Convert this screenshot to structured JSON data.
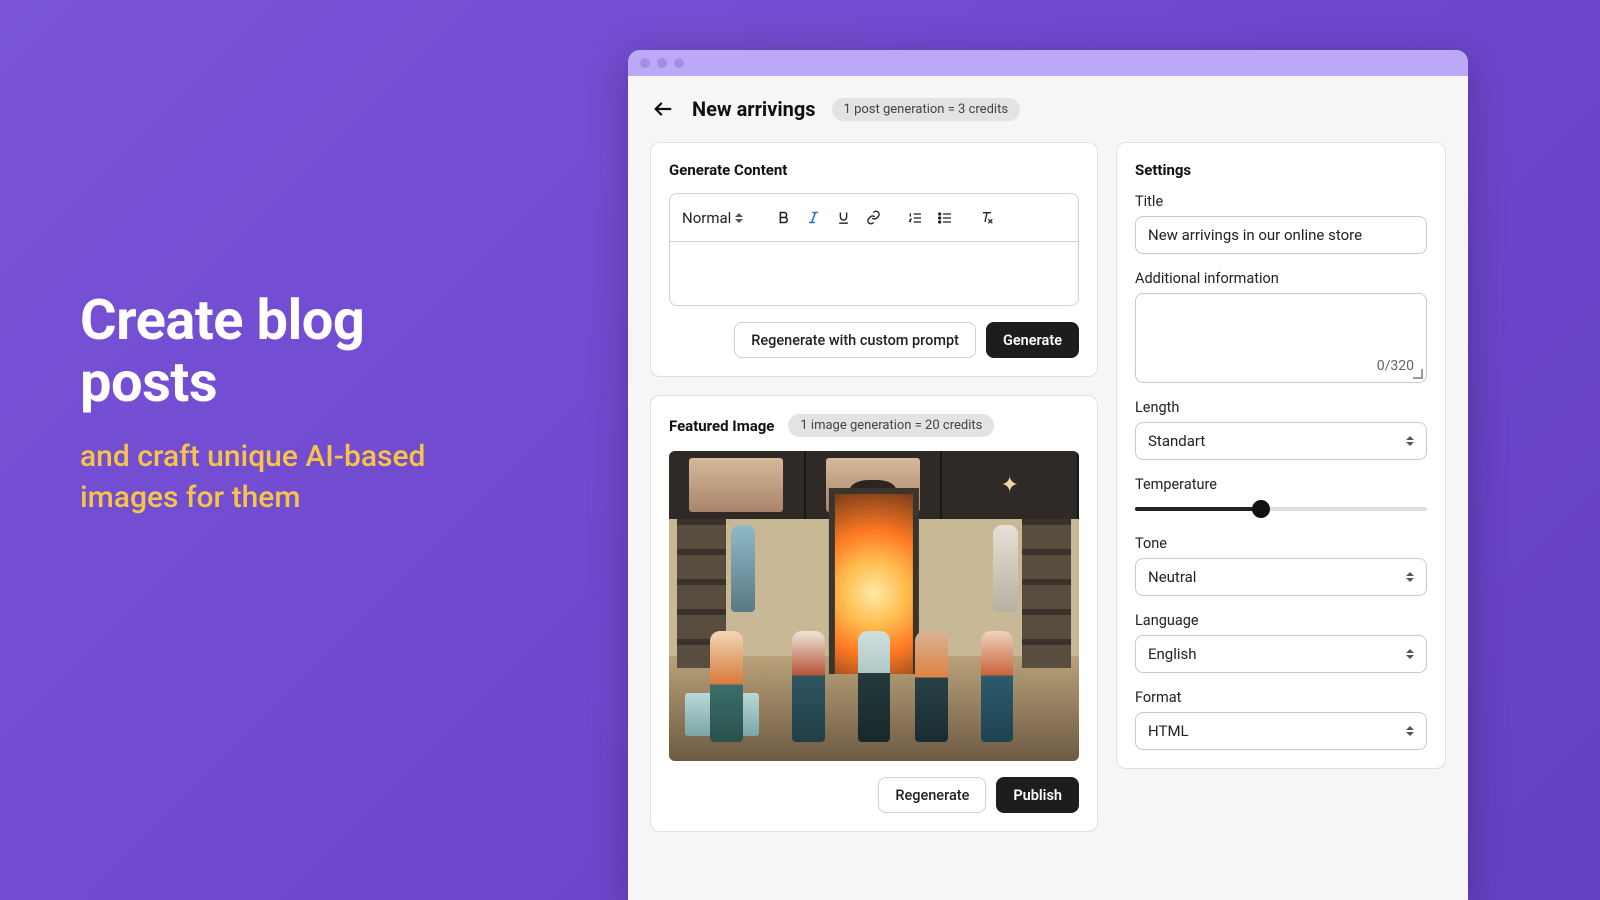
{
  "marketing": {
    "headline": "Create blog posts",
    "sub": "and craft unique AI-based images for them"
  },
  "header": {
    "page_title": "New arrivings",
    "credits_chip": "1 post generation = 3 credits"
  },
  "generate": {
    "title": "Generate Content",
    "format_label": "Normal",
    "btn_regenerate_custom": "Regenerate with custom prompt",
    "btn_generate": "Generate"
  },
  "featured": {
    "title": "Featured Image",
    "credits_chip": "1 image generation = 20 credits",
    "btn_regenerate": "Regenerate",
    "btn_publish": "Publish"
  },
  "settings": {
    "panel_title": "Settings",
    "title_label": "Title",
    "title_value": "New arrivings in our online store",
    "additional_label": "Additional information",
    "additional_counter": "0/320",
    "length_label": "Length",
    "length_value": "Standart",
    "temperature_label": "Temperature",
    "temperature_percent": 43,
    "tone_label": "Tone",
    "tone_value": "Neutral",
    "language_label": "Language",
    "language_value": "English",
    "format_label": "Format",
    "format_value": "HTML"
  },
  "icons": {
    "back": "arrow-left-icon",
    "bold": "bold-icon",
    "italic": "italic-icon",
    "underline": "underline-icon",
    "link": "link-icon",
    "list_ol": "ordered-list-icon",
    "list_ul": "unordered-list-icon",
    "clear": "clear-format-icon",
    "updown": "updown-chevron-icon"
  }
}
